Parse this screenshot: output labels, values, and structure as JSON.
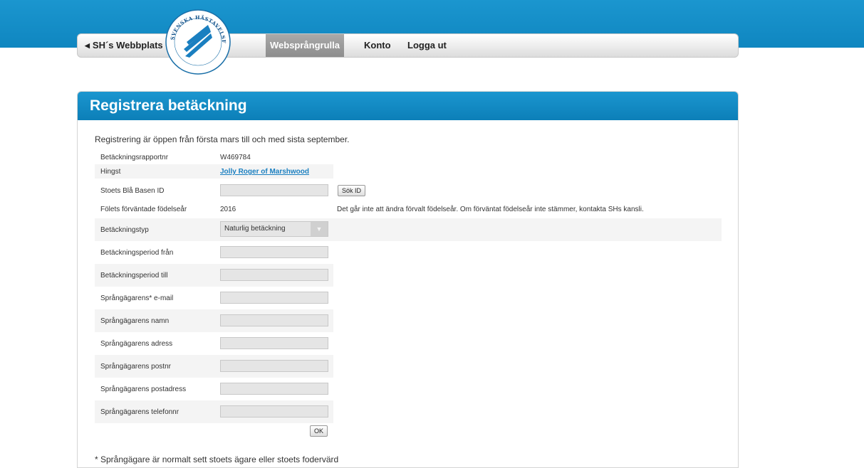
{
  "nav": {
    "back_label": "SH´s Webbplats",
    "items": [
      {
        "label": "Websprångrulla",
        "active": true
      },
      {
        "label": "Konto",
        "active": false
      },
      {
        "label": "Logga ut",
        "active": false
      }
    ]
  },
  "logo": {
    "text": "SVENSKA HÄSTAVELSFÖRBUNDET"
  },
  "panel": {
    "title": "Registrera betäckning",
    "intro": "Registrering är öppen från första mars till och med sista september."
  },
  "form": {
    "report_nr_label": "Betäckningsrapportnr",
    "report_nr_value": "W469784",
    "stallion_label": "Hingst",
    "stallion_value": "Jolly Roger of Marshwood",
    "mare_id_label": "Stoets Blå Basen ID",
    "mare_id_value": "",
    "search_button": "Sök ID",
    "foal_year_label": "Fölets förväntade födelseår",
    "foal_year_value": "2016",
    "foal_year_note": "Det går inte att ändra förvalt födelseår. Om förväntat födelseår inte stämmer, kontakta SHs kansli.",
    "covering_type_label": "Betäckningstyp",
    "covering_type_value": "Naturlig betäckning",
    "period_from_label": "Betäckningsperiod från",
    "period_to_label": "Betäckningsperiod till",
    "owner_email_label": "Språngägarens* e-mail",
    "owner_name_label": "Språngägarens namn",
    "owner_address_label": "Språngägarens adress",
    "owner_postnr_label": "Språngägarens postnr",
    "owner_postaddress_label": "Språngägarens postadress",
    "owner_phone_label": "Språngägarens telefonnr",
    "ok_button": "OK"
  },
  "footnote": "* Språngägare är normalt sett stoets ägare eller stoets fodervärd"
}
